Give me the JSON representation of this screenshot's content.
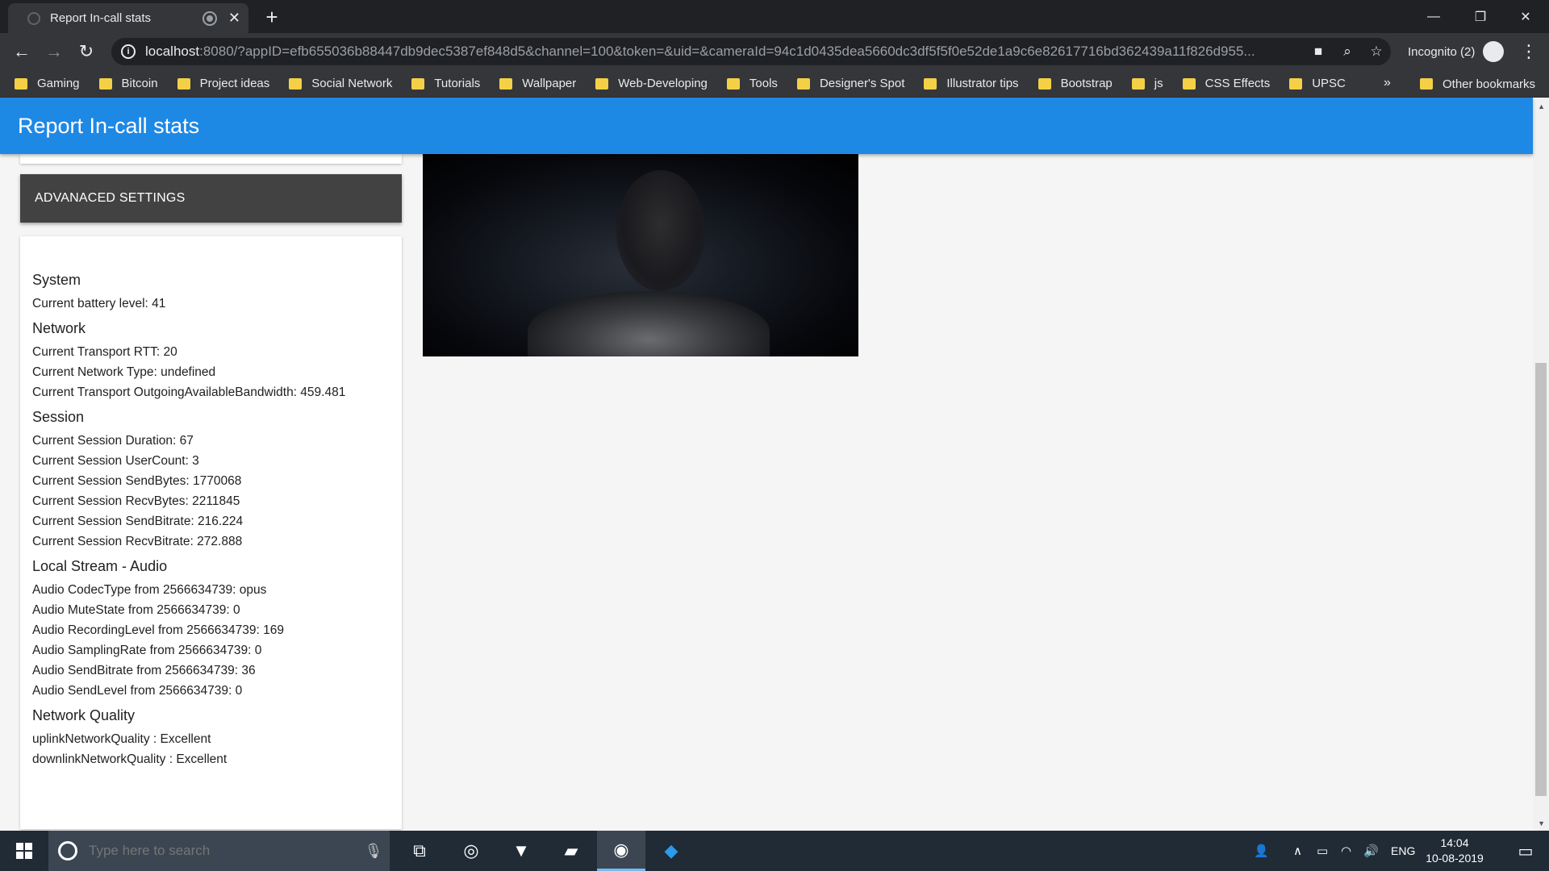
{
  "browser": {
    "tab_title": "Report In-call stats",
    "url_host": "localhost",
    "url_rest": ":8080/?appID=efb655036b88447db9dec5387ef848d5&channel=100&token=&uid=&cameraId=94c1d0435dea5660dc3df5f5f0e52de1a9c6e82617716bd362439a11f826d955...",
    "profile_label": "Incognito (2)",
    "bookmarks": [
      "Gaming",
      "Bitcoin",
      "Project ideas",
      "Social Network",
      "Tutorials",
      "Wallpaper",
      "Web-Developing",
      "Tools",
      "Designer's Spot",
      "Illustrator tips",
      "Bootstrap",
      "js",
      "CSS Effects",
      "UPSC"
    ],
    "bookmarks_overflow": "»",
    "other_bookmarks": "Other bookmarks"
  },
  "app": {
    "title": "Report In-call stats",
    "advanced_button": "ADVANACED SETTINGS"
  },
  "stats": {
    "system": {
      "heading": "System",
      "lines": [
        "Current battery level: 41"
      ]
    },
    "network": {
      "heading": "Network",
      "lines": [
        "Current Transport RTT: 20",
        "Current Network Type: undefined",
        "Current Transport OutgoingAvailableBandwidth: 459.481"
      ]
    },
    "session": {
      "heading": "Session",
      "lines": [
        "Current Session Duration: 67",
        "Current Session UserCount: 3",
        "Current Session SendBytes: 1770068",
        "Current Session RecvBytes: 2211845",
        "Current Session SendBitrate: 216.224",
        "Current Session RecvBitrate: 272.888"
      ]
    },
    "local_audio": {
      "heading": "Local Stream - Audio",
      "lines": [
        "Audio CodecType from 2566634739: opus",
        "Audio MuteState from 2566634739: 0",
        "Audio RecordingLevel from 2566634739: 169",
        "Audio SamplingRate from 2566634739: 0",
        "Audio SendBitrate from 2566634739: 36",
        "Audio SendLevel from 2566634739: 0"
      ]
    },
    "network_quality": {
      "heading": "Network Quality",
      "lines": [
        "uplinkNetworkQuality : Excellent",
        "downlinkNetworkQuality : Excellent"
      ]
    }
  },
  "taskbar": {
    "search_placeholder": "Type here to search",
    "language": "ENG",
    "time": "14:04",
    "date": "10-08-2019"
  },
  "colors": {
    "appbar": "#1e88e5",
    "advanced_button_bg": "#424242",
    "bookmark_folder": "#f4d046",
    "taskbar_bg": "#202b36"
  }
}
